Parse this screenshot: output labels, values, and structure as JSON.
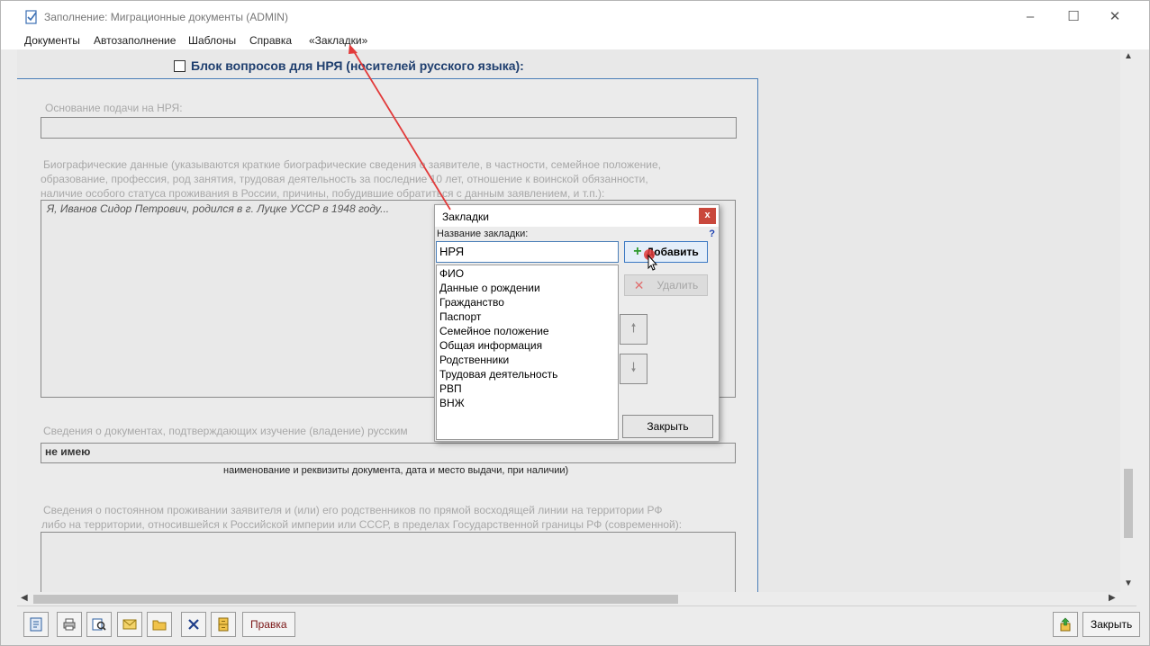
{
  "window": {
    "title": "Заполнение: Миграционные документы (ADMIN)",
    "controls": [
      "–",
      "☐",
      "✕"
    ]
  },
  "menu": [
    "Документы",
    "Автозаполнение",
    "Шаблоны",
    "Справка",
    "«Закладки»"
  ],
  "form": {
    "block_title": "Блок вопросов для НРЯ (носителей русского языка):",
    "basis_label": "Основание подачи на НРЯ:",
    "bio_label_1": "Биографические данные (указываются краткие биографические сведения о заявителе, в частности, семейное положение,",
    "bio_label_2": "образование, профессия, род занятия, трудовая деятельность за последние 10 лет, отношение к воинской обязанности,",
    "bio_label_3": "наличие особого статуса проживания в России, причины, побудившие обратиться с данным заявлением, и т.п.):",
    "bio_value": "Я, Иванов Сидор Петрович, родился в г. Луцке УССР в 1948 году...",
    "docs_label": "Сведения о документах, подтверждающих изучение (владение) русским",
    "docs_value": "не имею",
    "docs_caption": "наименование и реквизиты документа, дата и место выдачи, при наличии)",
    "residence_label_1": "Сведения о постоянном проживании заявителя и (или) его родственников по прямой восходящей линии на территории РФ",
    "residence_label_2": "либо на территории, относившейся к Российской империи или СССР, в пределах Государственной границы РФ (современной):"
  },
  "toolbar": {
    "pravka_label": "Правка",
    "close_label": "Закрыть"
  },
  "dialog": {
    "title": "Закладки",
    "close": "x",
    "help": "?",
    "name_label": "Название закладки:",
    "name_value": "НРЯ",
    "items": [
      "ФИО",
      "Данные о рождении",
      "Гражданство",
      "Паспорт",
      "Семейное положение",
      "Общая информация",
      "Родственники",
      "Трудовая деятельность",
      "РВП",
      "ВНЖ"
    ],
    "add_label": "Добавить",
    "delete_label": "Удалить",
    "up_icon": "🠕",
    "down_icon": "🠗",
    "close_label": "Закрыть"
  },
  "colors": {
    "accent": "#4b7fb8",
    "annotation": "#e23a3a",
    "title_blue": "#1f3f6f"
  }
}
